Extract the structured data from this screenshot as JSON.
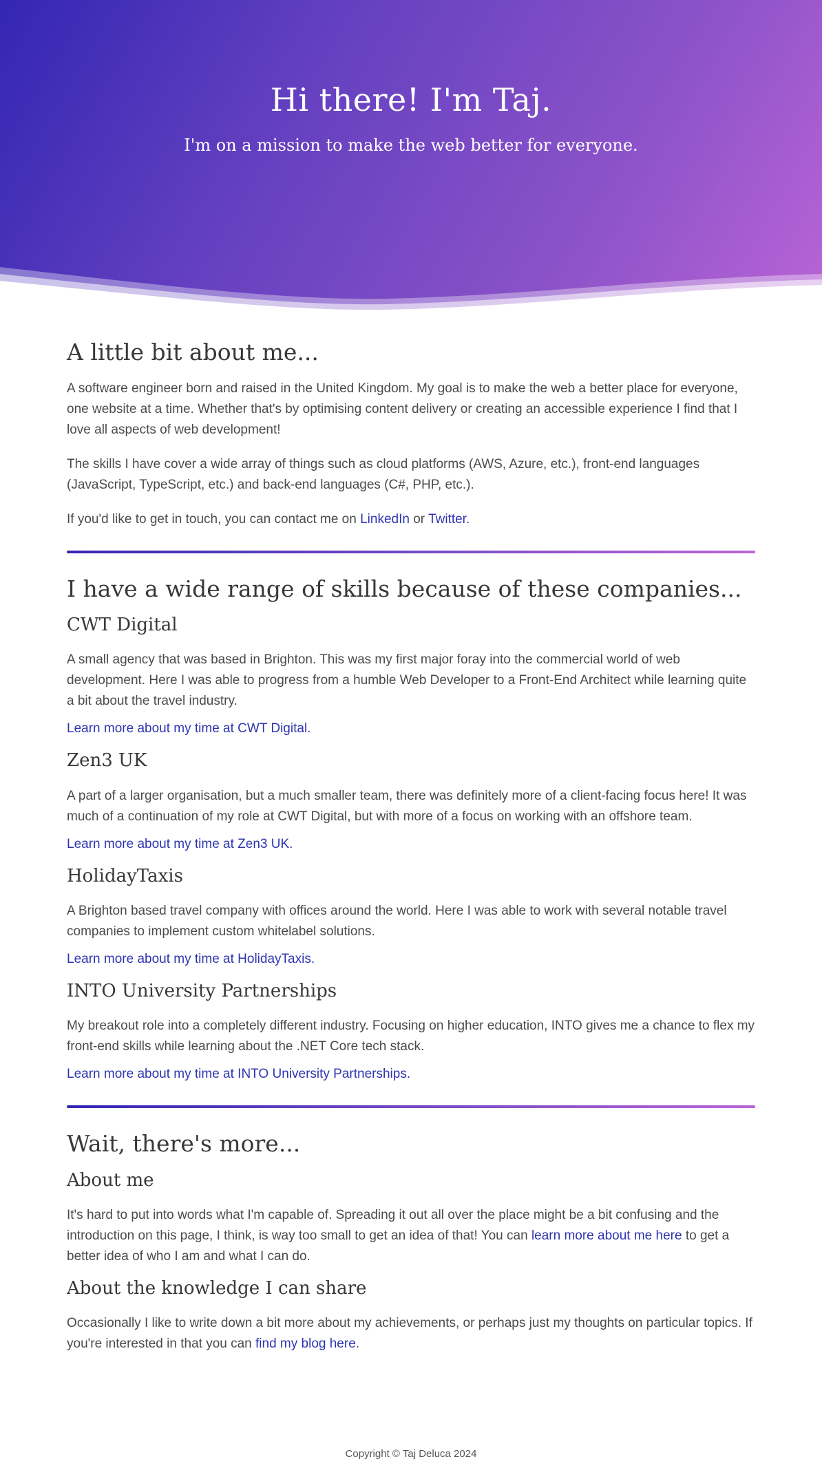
{
  "hero": {
    "title": "Hi there! I'm Taj.",
    "subtitle": "I'm on a mission to make the web better for everyone."
  },
  "about": {
    "heading": "A little bit about me...",
    "p1": "A software engineer born and raised in the United Kingdom. My goal is to make the web a better place for everyone, one website at a time. Whether that's by optimising content delivery or creating an accessible experience I find that I love all aspects of web development!",
    "p2": "The skills I have cover a wide array of things such as cloud platforms (AWS, Azure, etc.), front-end languages (JavaScript, TypeScript, etc.) and back-end languages (C#, PHP, etc.).",
    "contact_prefix": "If you'd like to get in touch, you can contact me on ",
    "linkedin_label": "LinkedIn",
    "contact_or": " or ",
    "twitter_label": "Twitter",
    "contact_suffix": "."
  },
  "companies": {
    "heading": "I have a wide range of skills because of these companies...",
    "items": [
      {
        "name": "CWT Digital",
        "description": "A small agency that was based in Brighton. This was my first major foray into the commercial world of web development. Here I was able to progress from a humble Web Developer to a Front-End Architect while learning quite a bit about the travel industry.",
        "link": "Learn more about my time at CWT Digital."
      },
      {
        "name": "Zen3 UK",
        "description": "A part of a larger organisation, but a much smaller team, there was definitely more of a client-facing focus here! It was much of a continuation of my role at CWT Digital, but with more of a focus on working with an offshore team.",
        "link": "Learn more about my time at Zen3 UK."
      },
      {
        "name": "HolidayTaxis",
        "description": "A Brighton based travel company with offices around the world. Here I was able to work with several notable travel companies to implement custom whitelabel solutions.",
        "link": "Learn more about my time at HolidayTaxis."
      },
      {
        "name": "INTO University Partnerships",
        "description": "My breakout role into a completely different industry. Focusing on higher education, INTO gives me a chance to flex my front-end skills while learning about the .NET Core tech stack.",
        "link": "Learn more about my time at INTO University Partnerships."
      }
    ]
  },
  "more": {
    "heading": "Wait, there's more...",
    "about_me": {
      "heading": "About me",
      "text_before": "It's hard to put into words what I'm capable of. Spreading it out all over the place might be a bit confusing and the introduction on this page, I think, is way too small to get an idea of that! You can ",
      "link": "learn more about me here",
      "text_after": " to get a better idea of who I am and what I can do."
    },
    "knowledge": {
      "heading": "About the knowledge I can share",
      "text_before": "Occasionally I like to write down a bit more about my achievements, or perhaps just my thoughts on particular topics. If you're interested in that you can ",
      "link": "find my blog here",
      "text_after": "."
    }
  },
  "footer": {
    "copyright": "Copyright © Taj Deluca 2024"
  },
  "colors": {
    "gradient_start": "#3326b3",
    "gradient_end": "#b964d6",
    "link": "#2e35b0"
  }
}
